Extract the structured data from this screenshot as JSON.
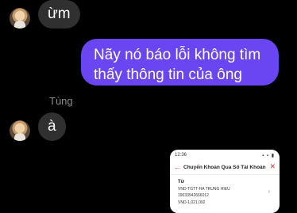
{
  "conversation": {
    "messages": [
      {
        "direction": "incoming",
        "text": "ừm"
      },
      {
        "direction": "outgoing",
        "text": "Nãy nó báo lỗi không tìm thấy thông tin của ông"
      },
      {
        "direction": "incoming",
        "sender": "Tùng",
        "text": "à"
      }
    ]
  },
  "shared_screenshot": {
    "status_time": "12:36",
    "status_icons": "▪ ▪ ▮",
    "title": "Chuyển Khoản Qua Số Tài Khoản",
    "from_label": "Từ",
    "account_name": "VND-TGTT-HA TRUNG HIEU",
    "account_number": "19033942666012",
    "partial_line": "VND-1,021,092"
  },
  "colors": {
    "background": "#000000",
    "incoming_bubble": "#303030",
    "outgoing_bubble": "#6a46f2",
    "accent_red": "#d33333"
  }
}
